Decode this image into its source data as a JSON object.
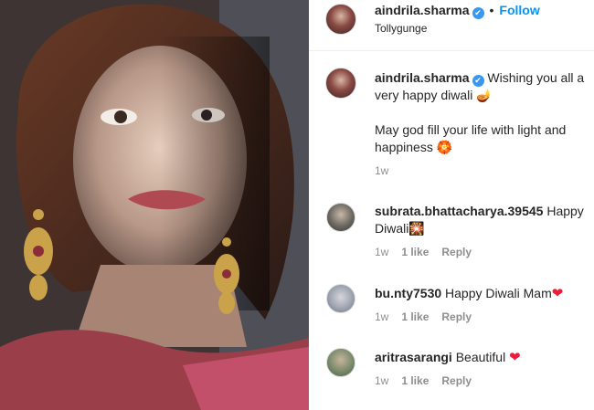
{
  "post": {
    "author": "aindrila.sharma",
    "follow_label": "Follow",
    "separator": "•",
    "location": "Tollygunge",
    "caption_author": "aindrila.sharma",
    "caption_line1": "Wishing you all a very happy diwali 🪔",
    "caption_line2": "May god fill your life with light and happiness 🏵️",
    "caption_time": "1w"
  },
  "comments": [
    {
      "username": "subrata.bhattacharya.39545",
      "text": "Happy Diwali🎇",
      "time": "1w",
      "likes": "1 like",
      "reply": "Reply"
    },
    {
      "username": "bu.nty7530",
      "text": "Happy Diwali Mam",
      "time": "1w",
      "likes": "1 like",
      "reply": "Reply"
    },
    {
      "username": "aritrasarangi",
      "text": "Beautiful",
      "time": "1w",
      "likes": "1 like",
      "reply": "Reply"
    }
  ],
  "icons": {
    "verified": "✔",
    "heart": "❤"
  },
  "colors": {
    "follow": "#0095f6",
    "verified": "#3897f0",
    "heart": "#ed1c3b",
    "meta": "#8e8e8e"
  }
}
